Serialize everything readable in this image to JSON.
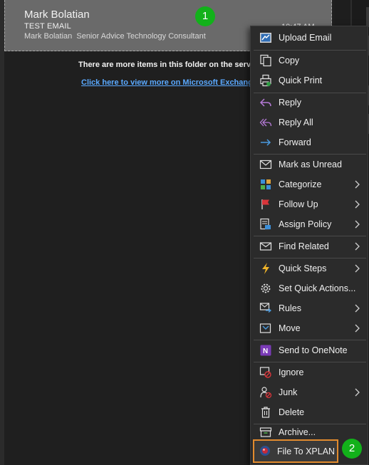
{
  "mail": {
    "from": "Mark Bolatian",
    "subject": "TEST EMAIL",
    "preview": "Mark Bolatian  Senior Advice Technology Consultant",
    "time": "10:47 AM"
  },
  "folder": {
    "more_items_text": "There are more items in this folder on the serv",
    "view_more_link": "Click here to view more on Microsoft Exchang"
  },
  "markers": [
    "1",
    "2"
  ],
  "context_menu": {
    "items": [
      {
        "label": "Upload Email",
        "icon": "upload-email-icon"
      },
      {
        "label": "Copy",
        "icon": "copy-icon"
      },
      {
        "label": "Quick Print",
        "icon": "print-icon"
      },
      {
        "label": "Reply",
        "icon": "reply-icon"
      },
      {
        "label": "Reply All",
        "icon": "reply-all-icon"
      },
      {
        "label": "Forward",
        "icon": "forward-icon"
      },
      {
        "label": "Mark as Unread",
        "icon": "envelope-icon"
      },
      {
        "label": "Categorize",
        "icon": "categorize-icon"
      },
      {
        "label": "Follow Up",
        "icon": "flag-icon"
      },
      {
        "label": "Assign Policy",
        "icon": "policy-icon"
      },
      {
        "label": "Find Related",
        "icon": "find-related-icon"
      },
      {
        "label": "Quick Steps",
        "icon": "lightning-icon"
      },
      {
        "label": "Set Quick Actions...",
        "icon": "gear-icon"
      },
      {
        "label": "Rules",
        "icon": "rules-icon"
      },
      {
        "label": "Move",
        "icon": "move-icon"
      },
      {
        "label": "Send to OneNote",
        "icon": "onenote-icon"
      },
      {
        "label": "Ignore",
        "icon": "ignore-icon"
      },
      {
        "label": "Junk",
        "icon": "junk-icon"
      },
      {
        "label": "Delete",
        "icon": "trash-icon"
      },
      {
        "label": "Archive...",
        "icon": "archive-icon"
      },
      {
        "label": "File To XPLAN",
        "icon": "xplan-icon"
      }
    ]
  },
  "colors": {
    "accent_green": "#12b11a",
    "highlight_orange": "#e28b2e",
    "link_blue": "#5aa9ff"
  }
}
